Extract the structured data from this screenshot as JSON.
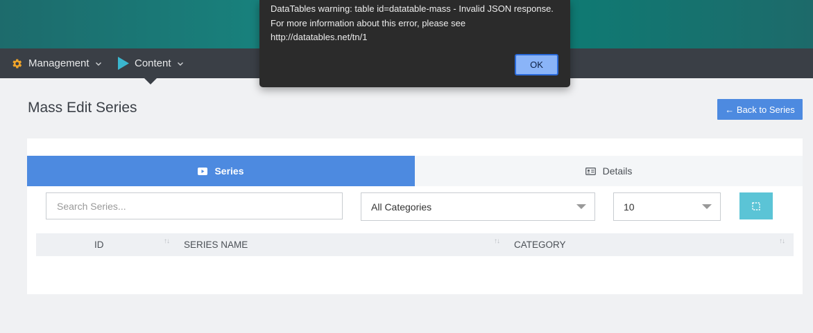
{
  "nav": {
    "management": "Management",
    "content": "Content"
  },
  "page": {
    "title": "Mass Edit Series",
    "back_button": "← Back to Series"
  },
  "tabs": {
    "series": "Series",
    "details": "Details"
  },
  "filters": {
    "search_placeholder": "Search Series...",
    "category_selected": "All Categories",
    "page_length_selected": "10"
  },
  "table": {
    "columns": [
      "ID",
      "SERIES NAME",
      "CATEGORY"
    ],
    "sort_glyph": "↑↓"
  },
  "dialog": {
    "message": "DataTables warning: table id=datatable-mass - Invalid JSON response. For more information about this error, please see http://datatables.net/tn/1",
    "ok_label": "OK"
  },
  "colors": {
    "accent": "#4d8ae0",
    "select_button": "#5bc4d6",
    "navbar": "#3a3f46",
    "topbar": "#168a83"
  }
}
